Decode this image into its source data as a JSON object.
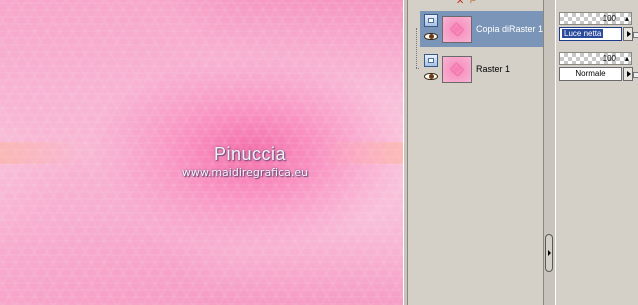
{
  "canvas": {
    "watermark_title": "Pinuccia",
    "watermark_url": "www.maidiregrafica.eu"
  },
  "layers": {
    "items": [
      {
        "name": "Copia diRaster 1",
        "selected": true,
        "opacity": "100",
        "blend_mode": "Luce netta"
      },
      {
        "name": "Raster 1",
        "selected": false,
        "opacity": "100",
        "blend_mode": "Normale"
      }
    ]
  },
  "icons": {
    "layer": "raster-layer-icon",
    "visibility": "eye-icon",
    "delete": "delete-icon",
    "scroll": "panel-expand-icon"
  },
  "colors": {
    "selection": "#7b95b8",
    "panel": "#d4d0c8",
    "canvas_pink": "#f58ab9"
  }
}
